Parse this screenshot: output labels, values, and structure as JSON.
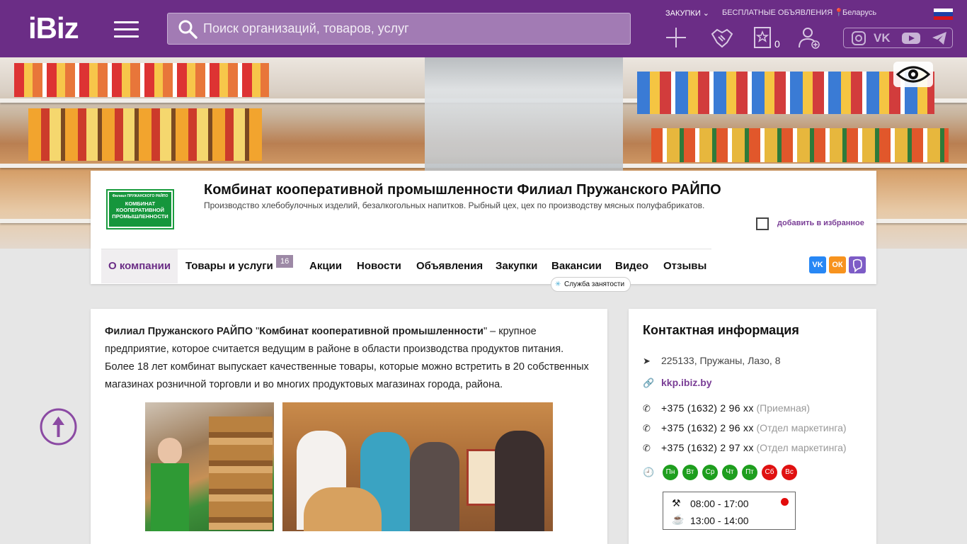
{
  "header": {
    "logo": "iBiz",
    "search_placeholder": "Поиск организаций, товаров, услуг",
    "links": {
      "purchases": "ЗАКУПКИ",
      "free_ads": "БЕСПЛАТНЫЕ ОБЪЯВЛЕНИЯ",
      "region": "Беларусь"
    },
    "favorites_count": "0",
    "language_flag": "ru",
    "social": [
      "instagram-icon",
      "vk-icon",
      "youtube-icon",
      "telegram-icon"
    ]
  },
  "company": {
    "logo_small": "Филиал ПРУЖАНСКОГО РАЙПО",
    "logo_line1": "КОМБИНАТ",
    "logo_line2": "КООПЕРАТИВНОЙ",
    "logo_line3": "ПРОМЫШЛЕННОСТИ",
    "title": "Комбинат кооперативной промышленности Филиал Пружанского РАЙПО",
    "subtitle": "Производство хлебобулочных изделий, безалкогольных напитков. Рыбный цех, цех по производству мясных полуфабрикатов.",
    "add_favorite": "добавить в избранное"
  },
  "tabs": [
    {
      "label": "О компании"
    },
    {
      "label": "Товары и услуги",
      "badge": "16"
    },
    {
      "label": "Акции"
    },
    {
      "label": "Новости"
    },
    {
      "label": "Объявления"
    },
    {
      "label": "Закупки"
    },
    {
      "label": "Вакансии"
    },
    {
      "label": "Видео"
    },
    {
      "label": "Отзывы"
    }
  ],
  "employment_service": "Служба занятости",
  "share": {
    "vk": "VK",
    "ok": "ОК",
    "viber": "Viber"
  },
  "about": {
    "text_bold1": "Филиал Пружанского РАЙПО",
    "q1": " \"",
    "text_bold2": "Комбинат кооперативной промышленности",
    "text_rest": "\" – крупное предприятие, которое считается ведущим в районе в области производства продуктов питания. Более 18 лет комбинат выпускает качественные товары, которые можно встретить в 20 собственных магазинах розничной торговли и во многих продуктовых магазинах города, района."
  },
  "contacts": {
    "title": "Контактная информация",
    "address": "225133, Пружаны, Лазо, 8",
    "site": "kkp.ibiz.by",
    "phones": [
      {
        "number": "+375 (1632) 2 96 xx",
        "note": "(Приемная)"
      },
      {
        "number": "+375 (1632) 2 96 xx",
        "note": "(Отдел маркетинга)"
      },
      {
        "number": "+375 (1632) 2 97 xx",
        "note": "(Отдел маркетинга)"
      }
    ],
    "days": [
      {
        "label": "Пн",
        "color": "#1e9e1e"
      },
      {
        "label": "Вт",
        "color": "#1e9e1e"
      },
      {
        "label": "Ср",
        "color": "#1e9e1e"
      },
      {
        "label": "Чт",
        "color": "#1e9e1e"
      },
      {
        "label": "Пт",
        "color": "#1e9e1e"
      },
      {
        "label": "Сб",
        "color": "#e01010"
      },
      {
        "label": "Вс",
        "color": "#e01010"
      }
    ],
    "work_hours": "08:00 - 17:00",
    "break_hours": "13:00 - 14:00"
  },
  "colors": {
    "brand": "#6b2d86",
    "link": "#7a3e96"
  }
}
